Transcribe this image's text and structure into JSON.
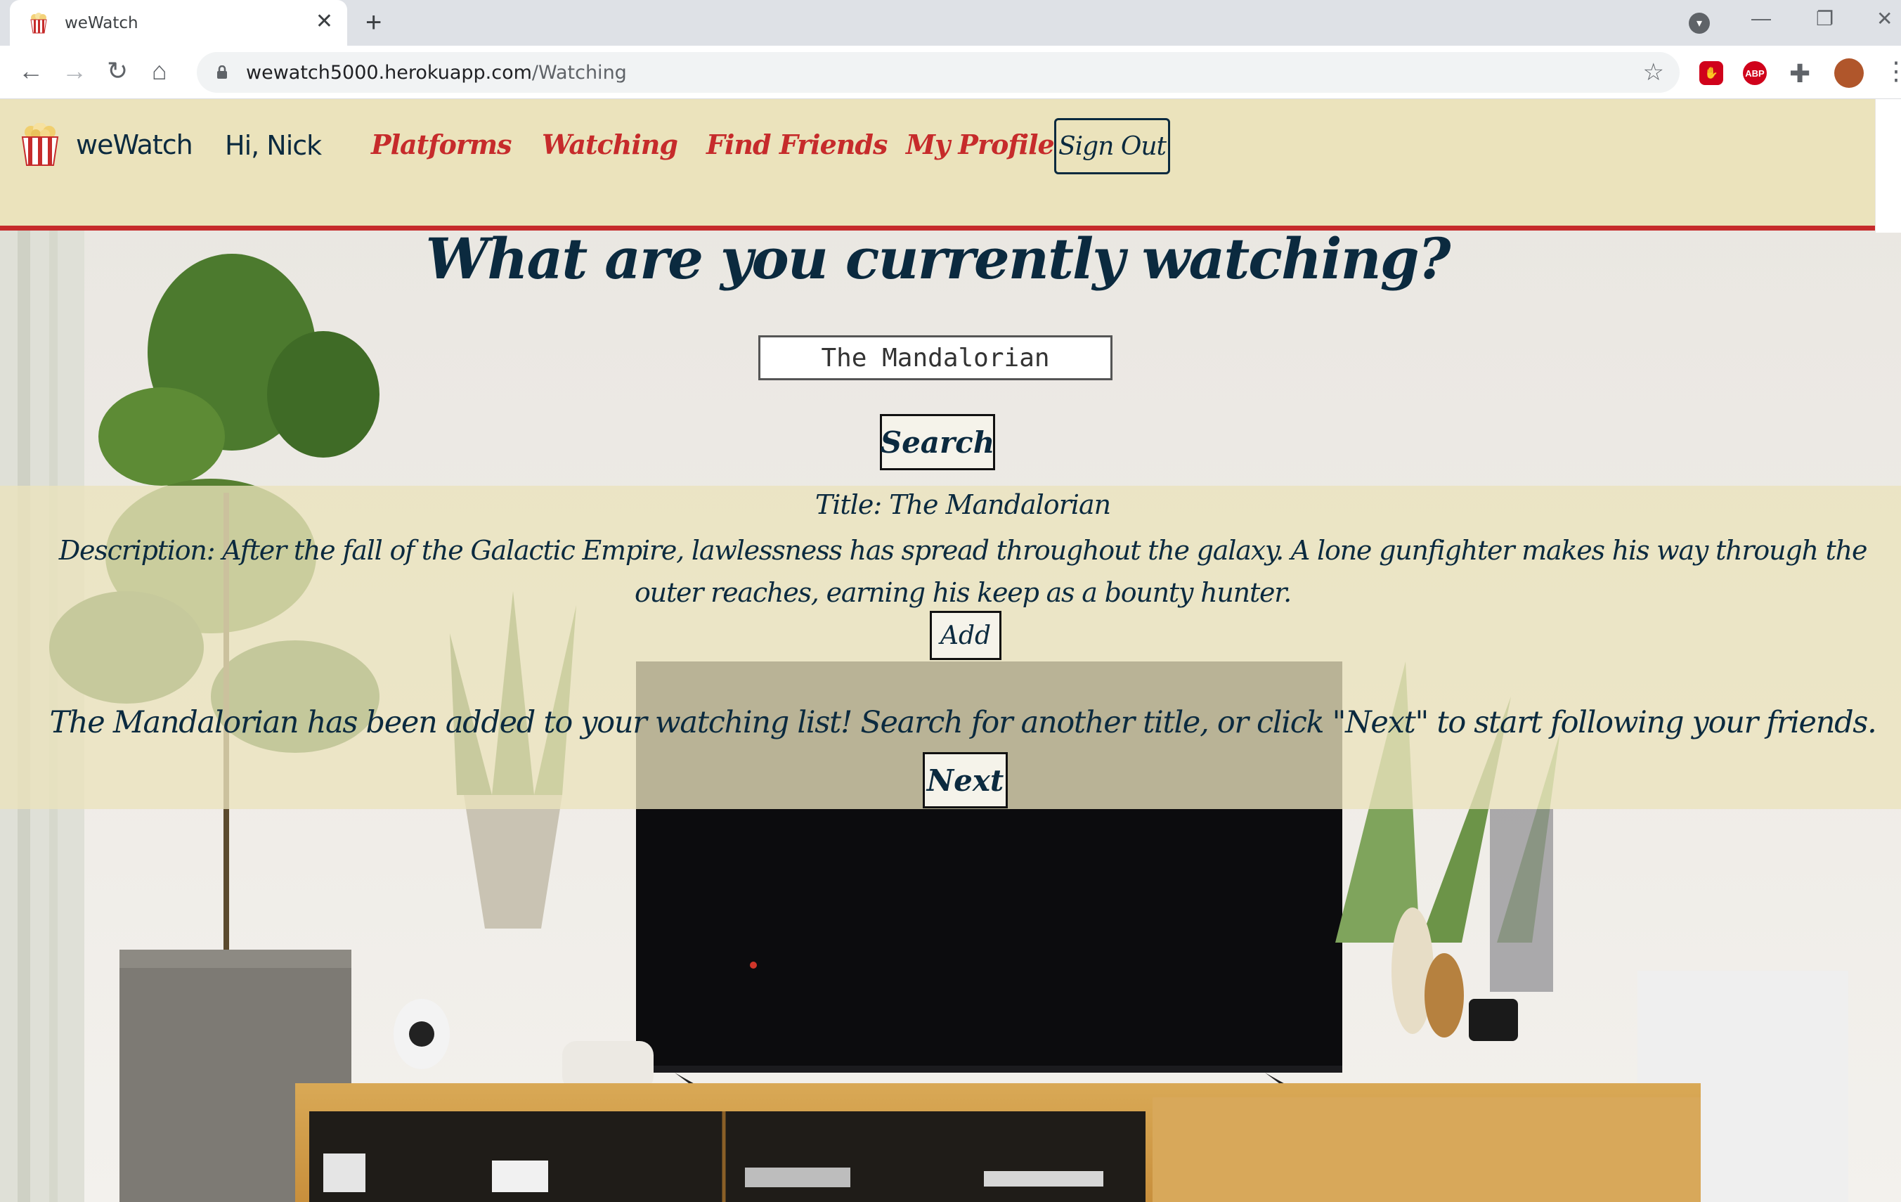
{
  "browser": {
    "tab_title": "weWatch",
    "tab_close": "✕",
    "new_tab": "+",
    "url_host": "wewatch5000.herokuapp.com",
    "url_path": "/Watching",
    "window_controls": {
      "minimize": "—",
      "restore": "❐",
      "close": "✕"
    },
    "extensions": {
      "abp_label": "ABP"
    }
  },
  "header": {
    "brand": "weWatch",
    "greeting": "Hi, Nick",
    "nav": [
      "Platforms",
      "Watching",
      "Find Friends",
      "My Profile"
    ],
    "sign_out": "Sign Out"
  },
  "colors": {
    "header_bg": "#ebe3bc",
    "accent_red": "#c62b2b",
    "navy": "#0b2a3f"
  },
  "main": {
    "heading": "What are you currently watching?",
    "search_value": "The Mandalorian",
    "search_button": "Search",
    "result": {
      "title": "Title: The Mandalorian",
      "description": "Description: After the fall of the Galactic Empire, lawlessness has spread throughout the galaxy. A lone gunfighter makes his way through the outer reaches, earning his keep as a bounty hunter.",
      "add_button": "Add"
    },
    "confirmation": "The Mandalorian has been added to your watching list! Search for another title, or click \"Next\" to start following your friends.",
    "next_button": "Next"
  }
}
